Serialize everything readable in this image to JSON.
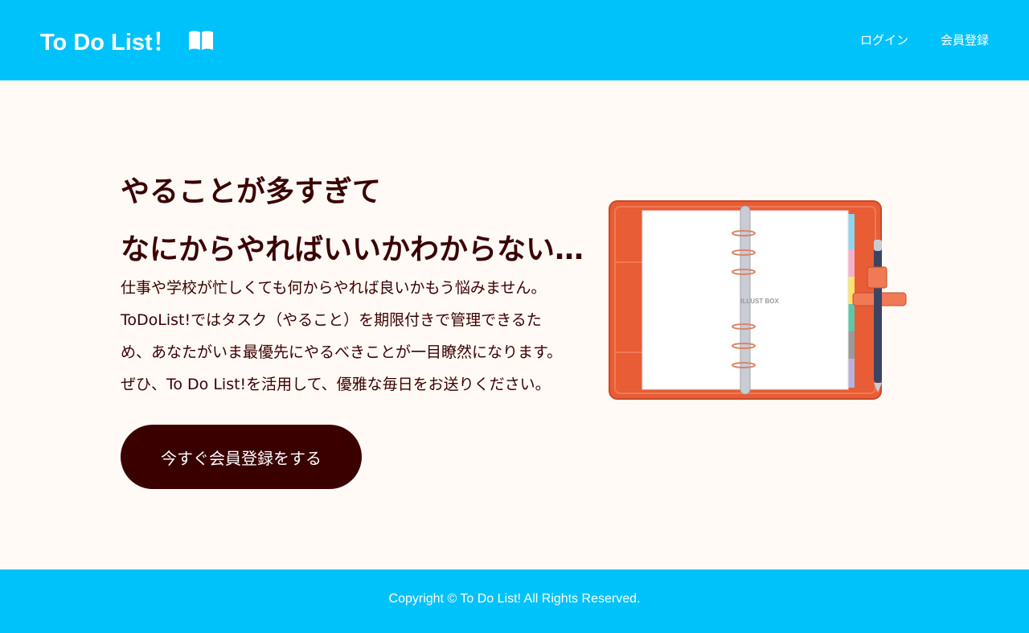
{
  "header": {
    "logo_text": "To Do List！",
    "logo_icon": "open-book-icon",
    "nav": [
      {
        "label": "ログイン"
      },
      {
        "label": "会員登録"
      }
    ]
  },
  "hero": {
    "headline_line1": "やることが多すぎて",
    "headline_line2": "なにからやればいいかわからない…",
    "description": [
      "仕事や学校が忙しくても何からやれば良いかもう悩みません。",
      "ToDoList!ではタスク（やること）を期限付きで管理できるた",
      "め、あなたがいま最優先にやるべきことが一目瞭然になります。",
      "ぜひ、To Do List!を活用して、優雅な毎日をお送りください。"
    ],
    "cta_label": "今すぐ会員登録をする",
    "illustration_label": "ILLUST BOX"
  },
  "footer": {
    "copyright": "Copyright © To Do List! All Rights Reserved."
  },
  "colors": {
    "header_bg": "#00c2fb",
    "page_bg": "#fffaf6",
    "text_dark": "#3a0000",
    "cta_bg": "#3a0000",
    "planner_cover": "#e85c36"
  }
}
